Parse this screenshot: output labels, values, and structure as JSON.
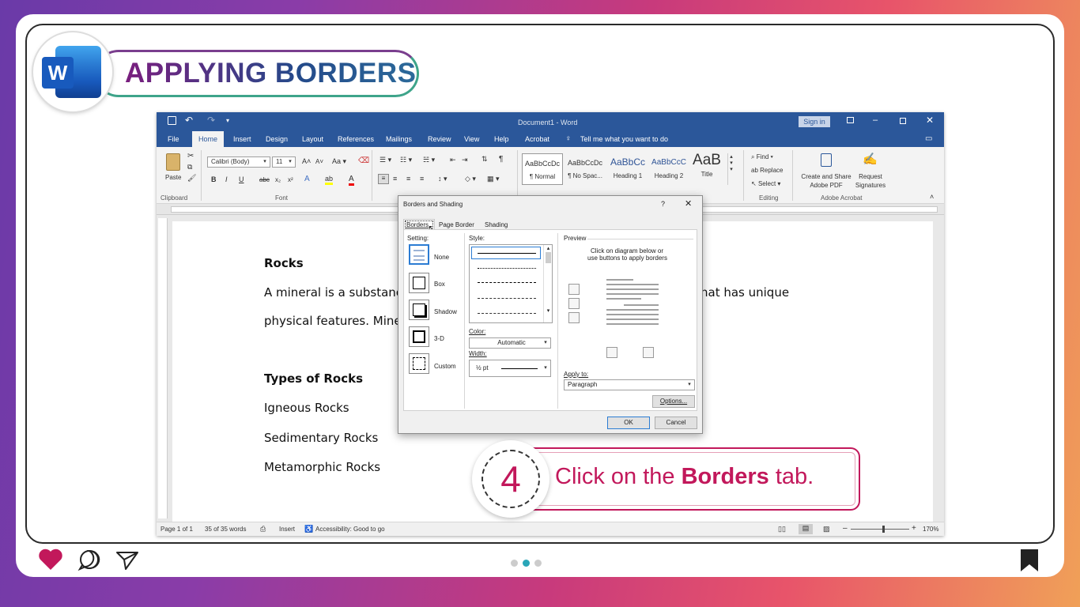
{
  "banner": {
    "title": "APPLYING BORDERS",
    "logo_letter": "W"
  },
  "window": {
    "title": "Document1 - Word",
    "sign_in": "Sign in",
    "tabs": [
      "File",
      "Home",
      "Insert",
      "Design",
      "Layout",
      "References",
      "Mailings",
      "Review",
      "View",
      "Help",
      "Acrobat"
    ],
    "tell_me": "Tell me what you want to do",
    "ribbon": {
      "paste": "Paste",
      "clipboard": "Clipboard",
      "font_name": "Calibri (Body)",
      "font_size": "11",
      "font": "Font",
      "styles": [
        {
          "sample": "AaBbCcDc",
          "name": "¶ Normal"
        },
        {
          "sample": "AaBbCcDc",
          "name": "¶ No Spac..."
        },
        {
          "sample": "AaBbCc",
          "name": "Heading 1"
        },
        {
          "sample": "AaBbCcC",
          "name": "Heading 2"
        },
        {
          "sample": "AaB",
          "name": "Title"
        }
      ],
      "find": "Find",
      "replace": "Replace",
      "select": "Select",
      "editing": "Editing",
      "create_share": "Create and Share",
      "adobe_pdf": "Adobe PDF",
      "request": "Request",
      "signatures": "Signatures",
      "adobe_acrobat": "Adobe Acrobat"
    },
    "document": {
      "heading1": "Rocks",
      "para_line1_start": "A mineral is a substanc",
      "para_line1_end": "hat has unique",
      "para_line2_start": "physical features. Mine",
      "heading2": "Types of Rocks",
      "items": [
        "Igneous Rocks",
        "Sedimentary Rocks",
        "Metamorphic Rocks"
      ]
    },
    "status": {
      "page": "Page 1 of 1",
      "words": "35 of 35 words",
      "insert": "Insert",
      "accessibility": "Accessibility: Good to go",
      "zoom": "170%"
    }
  },
  "dialog": {
    "title": "Borders and Shading",
    "help": "?",
    "tabs": [
      "Borders",
      "Page Border",
      "Shading"
    ],
    "setting_label": "Setting:",
    "settings": [
      "None",
      "Box",
      "Shadow",
      "3-D",
      "Custom"
    ],
    "style_label": "Style:",
    "color_label": "Color:",
    "color_value": "Automatic",
    "width_label": "Width:",
    "width_value": "½ pt",
    "preview_label": "Preview",
    "preview_hint1": "Click on diagram below or",
    "preview_hint2": "use buttons to apply borders",
    "apply_to_label": "Apply to:",
    "apply_to_value": "Paragraph",
    "options": "Options...",
    "ok": "OK",
    "cancel": "Cancel"
  },
  "step": {
    "number": "4",
    "text_before": "Click on the ",
    "text_bold": "Borders",
    "text_after": " tab."
  }
}
